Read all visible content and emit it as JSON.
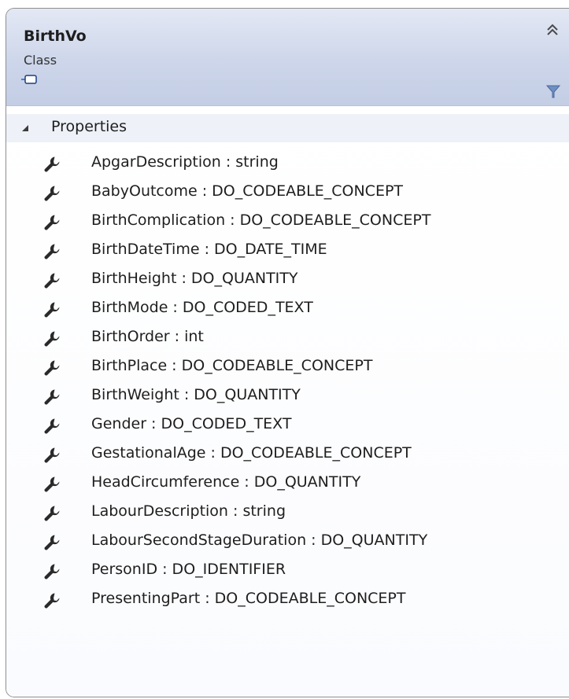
{
  "class_shape": {
    "name": "BirthVo",
    "kind": "Class",
    "collapse_icon": "double-chevron-up-icon",
    "toggle_icon": "toggle-switch-icon",
    "filter_icon": "filter-funnel-icon"
  },
  "properties_section": {
    "label": "Properties",
    "expand_icon": "triangle-down-icon",
    "item_icon": "wrench-icon",
    "items": [
      {
        "text": "ApgarDescription : string"
      },
      {
        "text": "BabyOutcome : DO_CODEABLE_CONCEPT"
      },
      {
        "text": "BirthComplication : DO_CODEABLE_CONCEPT"
      },
      {
        "text": "BirthDateTime : DO_DATE_TIME"
      },
      {
        "text": "BirthHeight : DO_QUANTITY"
      },
      {
        "text": "BirthMode : DO_CODED_TEXT"
      },
      {
        "text": "BirthOrder : int"
      },
      {
        "text": "BirthPlace : DO_CODEABLE_CONCEPT"
      },
      {
        "text": "BirthWeight : DO_QUANTITY"
      },
      {
        "text": "Gender : DO_CODED_TEXT"
      },
      {
        "text": "GestationalAge : DO_CODEABLE_CONCEPT"
      },
      {
        "text": "HeadCircumference : DO_QUANTITY"
      },
      {
        "text": "LabourDescription : string"
      },
      {
        "text": "LabourSecondStageDuration : DO_QUANTITY"
      },
      {
        "text": "PersonID : DO_IDENTIFIER"
      },
      {
        "text": "PresentingPart : DO_CODEABLE_CONCEPT"
      }
    ]
  }
}
